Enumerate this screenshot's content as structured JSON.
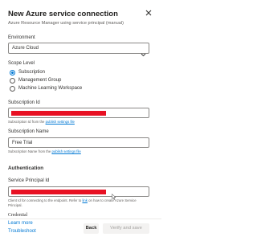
{
  "header": {
    "title": "New Azure service connection",
    "subtitle": "Azure Resource Manager using service principal (manual)"
  },
  "environment": {
    "label": "Environment",
    "value": "Azure Cloud"
  },
  "scope": {
    "label": "Scope Level",
    "options": [
      "Subscription",
      "Management Group",
      "Machine Learning Workspace"
    ],
    "selected": "Subscription"
  },
  "subscription_id": {
    "label": "Subscription Id",
    "hint_prefix": "Subscription Id from the",
    "hint_link": "publish settings file"
  },
  "subscription_name": {
    "label": "Subscription Name",
    "value": "Free Trial",
    "hint_prefix": "Subscription Name from the",
    "hint_link": "publish settings file"
  },
  "authentication": {
    "section_title": "Authentication",
    "sp_label": "Service Principal Id",
    "hint_line1_prefix": "Client Id for connecting to the endpoint. Refer to",
    "hint_line1_link": "link",
    "hint_line1_suffix": "on how to create Azure Service",
    "hint_line2": "Principal."
  },
  "credential_label": "Credential",
  "footer": {
    "learn_more": "Learn more",
    "troubleshoot": "Troubleshoot",
    "back_label": "Back",
    "verify_label": "Verify and save"
  },
  "colors": {
    "accent": "#0078d4",
    "redaction": "#e81123"
  }
}
